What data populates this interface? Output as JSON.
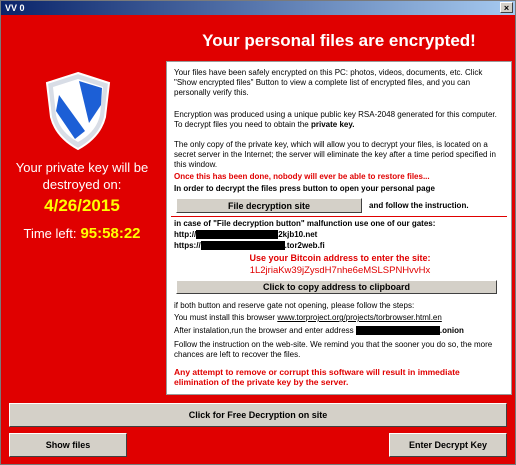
{
  "window": {
    "title": "VV 0",
    "close_glyph": "×"
  },
  "heading": "Your personal files are encrypted!",
  "left": {
    "destroy_line1": "Your private key will be",
    "destroy_line2": "destroyed on:",
    "date": "4/26/2015",
    "time_left_label": "Time left:",
    "time_left_value": "95:58:22"
  },
  "panel": {
    "p1": "Your files have been safely encrypted on this PC: photos, videos, documents, etc. Click \"Show encrypted files\" Button to view a complete list of encrypted files, and you can personally verify this.",
    "p2_a": "Encryption was produced using a unique public key RSA-2048 generated for this computer. To decrypt files you need to obtain the ",
    "p2_b": "private key.",
    "p3": "The only copy of the private key, which will allow you to decrypt your files, is located on a secret server in the Internet; the server will eliminate the key after a time period specified in this window.",
    "warn1": "Once this has been done, nobody will ever be able to restore files...",
    "instr": "In order to decrypt the files press button to open your personal page",
    "decrypt_site_btn": "File decryption site",
    "follow": "and follow the instruction.",
    "malfunction": "in case of \"File decryption button\" malfunction use one of our gates:",
    "gate1_prefix": "http://",
    "gate1_suffix": "2kjb10.net",
    "gate2_prefix": "https://",
    "gate2_suffix": ".tor2web.fi",
    "bitcoin_label": "Use your Bitcoin address to  enter the site:",
    "bitcoin_address": "1L2jriaKw39jZysdH7nhe6eMSLSPNHvvHx",
    "copy_btn": "Click to copy address to clipboard",
    "both_fail": "if both button and reserve gate not opening, please follow the steps:",
    "install_prefix": "You must install this browser ",
    "install_link": "www.torproject.org/projects/torbrowser.html.en",
    "after_install": "After instalation,run the browser and enter address",
    "onion_suffix": ".onion",
    "follow_web": "Follow the instruction on the web-site. We remind you that the sooner you do so, the more chances are left to recover the files.",
    "warn2": "Any attempt to remove or corrupt this software will result in immediate elimination of the private key by the server."
  },
  "buttons": {
    "free_decrypt": "Click for Free Decryption on site",
    "show_files": "Show files",
    "enter_key": "Enter Decrypt Key"
  },
  "colors": {
    "background": "#e00000",
    "accent_yellow": "#ffff00",
    "shield_blue": "#1c5fd6"
  }
}
